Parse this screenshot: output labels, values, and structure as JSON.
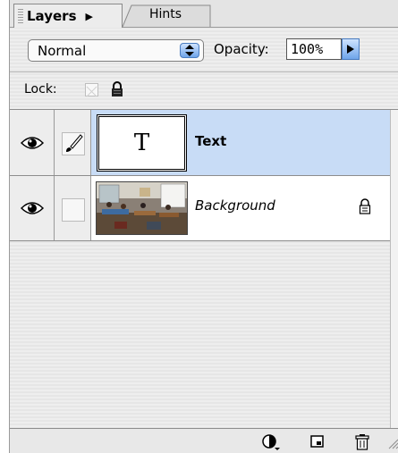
{
  "tabs": {
    "active": "Layers",
    "inactive": "Hints"
  },
  "controls": {
    "blend_mode": "Normal",
    "opacity_label": "Opacity:",
    "opacity_value": "100%",
    "lock_label": "Lock:"
  },
  "layers": [
    {
      "name": "Text",
      "thumbnail_glyph": "T",
      "visible": true,
      "selected": true,
      "icon": "brush-icon"
    },
    {
      "name": "Background",
      "visible": true,
      "selected": false,
      "locked": true
    }
  ],
  "footer": {
    "icons": [
      "adjustment-layer-icon",
      "new-layer-icon",
      "trash-icon"
    ]
  },
  "colors": {
    "selection": "#c8dcf6",
    "accent": "#6fa5ea",
    "panel": "#ececec"
  }
}
